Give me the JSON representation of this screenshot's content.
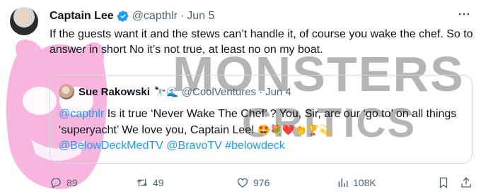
{
  "watermark": {
    "line1": "MONSTERS",
    "line2": "CRITICS"
  },
  "tweet": {
    "name": "Captain Lee",
    "handle": "@capthlr",
    "separator": "·",
    "date": "Jun 5",
    "more_icon": "more-dots-icon",
    "text": "If the guests want it and the stews can’t handle it, of course you wake the chef. So to answer in short No it’s not true, at least no on my boat."
  },
  "quote": {
    "name": "Sue Rakowski",
    "emojis": "🔭🌊",
    "handle": "@CoolVentures",
    "separator": "·",
    "date": "Jun 4",
    "mention": "@capthlr",
    "text": " Is it true ‘Never Wake The Chef’ ? You, Sir, are our ‘go to’ on all things ‘superyacht’ We love you, Captain Lee! ",
    "text_emojis": "🤩💐❤️👏🏆💫",
    "tags": [
      "@BelowDeckMedTV",
      "@BravoTV",
      "#belowdeck"
    ]
  },
  "actions": {
    "replies": "89",
    "retweets": "49",
    "likes": "976",
    "views": "108K"
  },
  "colors": {
    "link": "#1d9bf0",
    "muted": "#536471",
    "verified": "#1d9bf0",
    "watermark_pink": "#f7a8d8"
  }
}
